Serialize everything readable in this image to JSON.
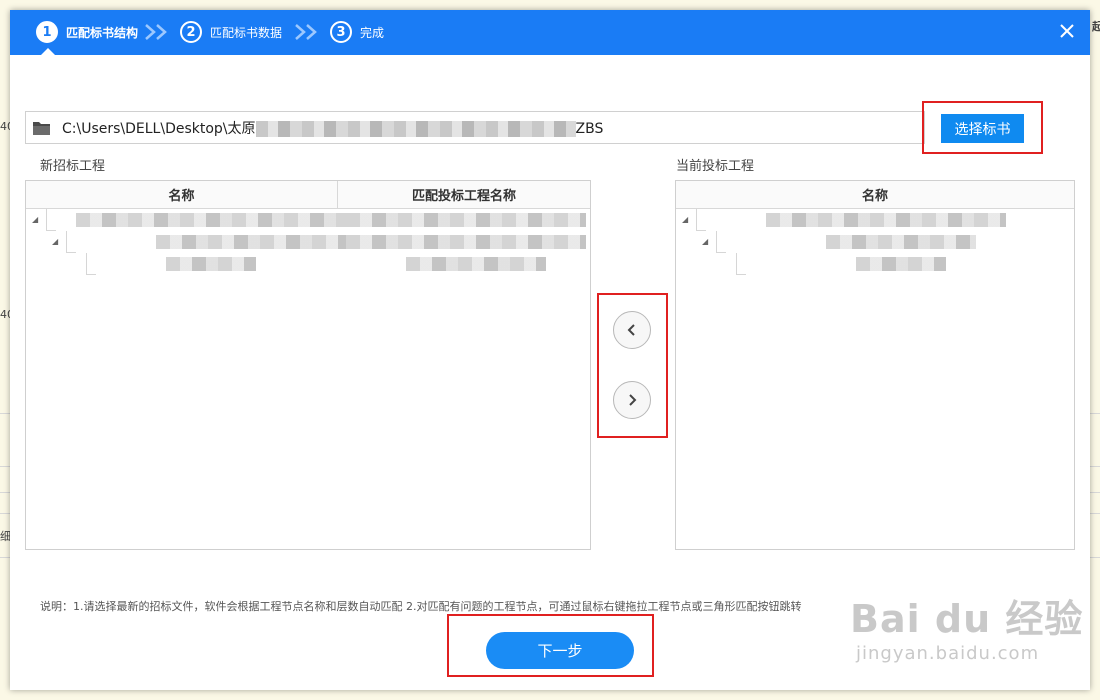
{
  "background": {
    "fragment_1": "40",
    "fragment_2": "40",
    "fragment_3": "细",
    "fragment_4": "起"
  },
  "steps": [
    {
      "number": "1",
      "label": "匹配标书结构"
    },
    {
      "number": "2",
      "label": "匹配标书数据"
    },
    {
      "number": "3",
      "label": "完成"
    }
  ],
  "file_path": {
    "prefix": "C:\\Users\\DELL\\Desktop\\太原",
    "suffix": "ZBS"
  },
  "select_button_label": "选择标书",
  "left_panel": {
    "title": "新招标工程",
    "col_name": "名称",
    "col_match": "匹配投标工程名称"
  },
  "right_panel": {
    "title": "当前投标工程",
    "col_name": "名称"
  },
  "note": "说明：1.请选择最新的招标文件，软件会根据工程节点名称和层数自动匹配    2.对匹配有问题的工程节点，可通过鼠标右键拖拉工程节点或三角形匹配按钮跳转",
  "next_button_label": "下一步",
  "watermark": {
    "main": "Bai du 经验",
    "sub": "jingyan.baidu.com"
  },
  "colors": {
    "accent": "#1a7cf5",
    "highlight": "#e02020"
  }
}
